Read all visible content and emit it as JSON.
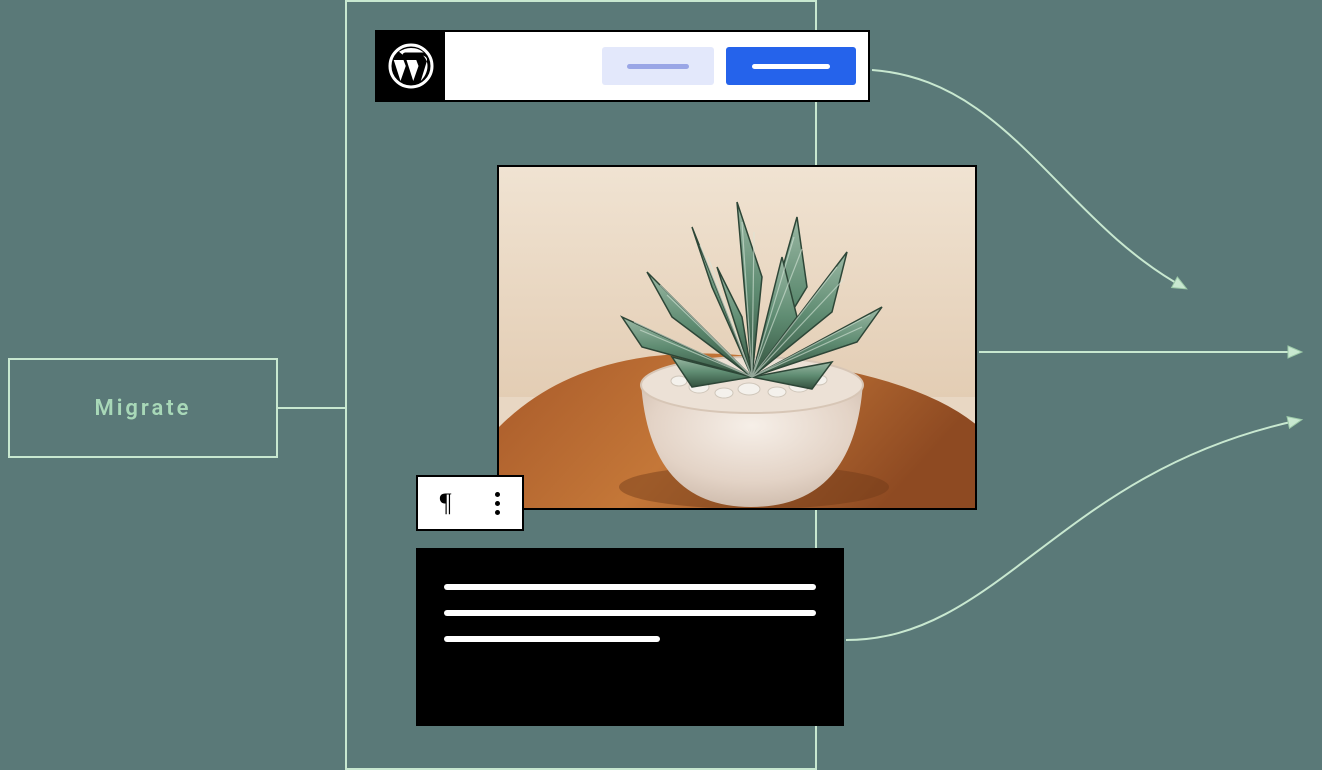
{
  "migrate": {
    "label": "Migrate"
  },
  "colors": {
    "background": "#5a7978",
    "outline": "#c8e8d0",
    "accent_blue": "#2563eb",
    "accent_lavender": "#e3e8fb"
  },
  "icons": {
    "wordpress": "wordpress-icon",
    "paragraph": "pilcrow-icon",
    "more": "more-vertical-icon"
  },
  "wordpress_bar": {
    "button_light": "light-button",
    "button_primary": "primary-button"
  },
  "photo": {
    "description": "succulent-plant-in-ceramic-pot"
  },
  "text_block": {
    "lines": [
      100,
      100,
      60
    ]
  }
}
